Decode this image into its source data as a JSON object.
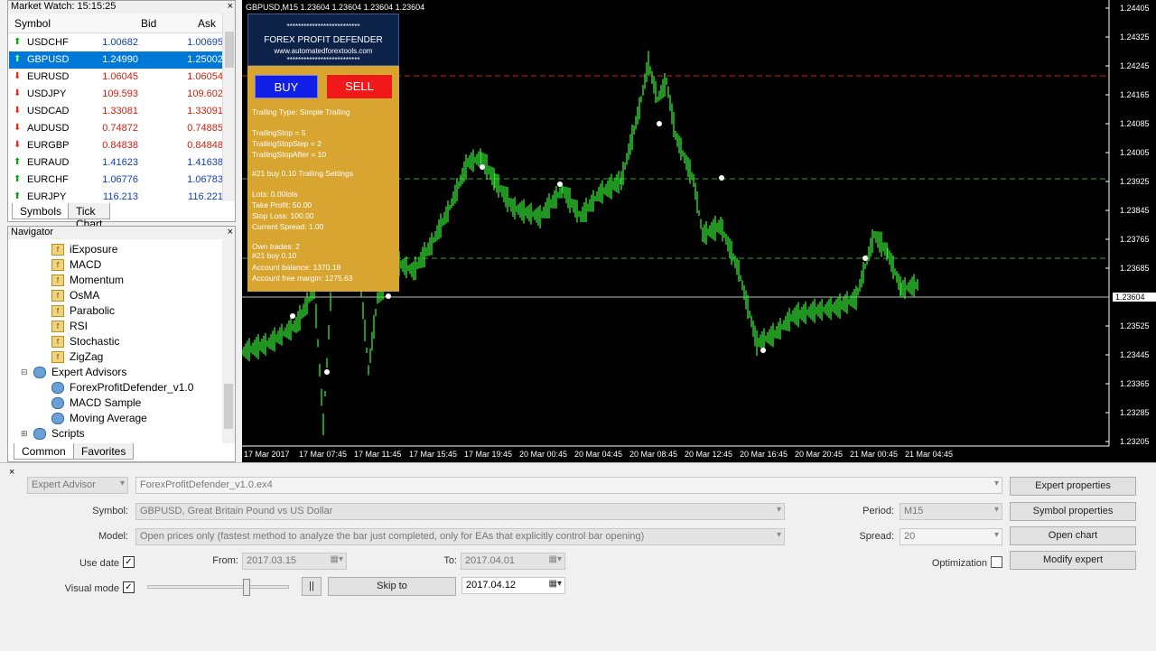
{
  "market_watch": {
    "title": "Market Watch: 15:15:25",
    "col_symbol": "Symbol",
    "col_bid": "Bid",
    "col_ask": "Ask",
    "rows": [
      {
        "symbol": "USDCHF",
        "bid": "1.00682",
        "ask": "1.00695",
        "dir": "up",
        "color": "blue"
      },
      {
        "symbol": "GBPUSD",
        "bid": "1.24990",
        "ask": "1.25002",
        "dir": "up",
        "color": "selected"
      },
      {
        "symbol": "EURUSD",
        "bid": "1.06045",
        "ask": "1.06054",
        "dir": "down",
        "color": "red"
      },
      {
        "symbol": "USDJPY",
        "bid": "109.593",
        "ask": "109.602",
        "dir": "down",
        "color": "red"
      },
      {
        "symbol": "USDCAD",
        "bid": "1.33081",
        "ask": "1.33091",
        "dir": "down",
        "color": "red"
      },
      {
        "symbol": "AUDUSD",
        "bid": "0.74872",
        "ask": "0.74885",
        "dir": "down",
        "color": "red"
      },
      {
        "symbol": "EURGBP",
        "bid": "0.84838",
        "ask": "0.84848",
        "dir": "down",
        "color": "red"
      },
      {
        "symbol": "EURAUD",
        "bid": "1.41623",
        "ask": "1.41638",
        "dir": "up",
        "color": "blue"
      },
      {
        "symbol": "EURCHF",
        "bid": "1.06776",
        "ask": "1.06783",
        "dir": "up",
        "color": "blue"
      },
      {
        "symbol": "EURJPY",
        "bid": "116.213",
        "ask": "116.221",
        "dir": "up",
        "color": "blue"
      }
    ],
    "tabs": [
      "Symbols",
      "Tick Chart"
    ]
  },
  "navigator": {
    "title": "Navigator",
    "items": [
      {
        "label": "iExposure",
        "type": "indicator"
      },
      {
        "label": "MACD",
        "type": "indicator"
      },
      {
        "label": "Momentum",
        "type": "indicator"
      },
      {
        "label": "OsMA",
        "type": "indicator"
      },
      {
        "label": "Parabolic",
        "type": "indicator"
      },
      {
        "label": "RSI",
        "type": "indicator"
      },
      {
        "label": "Stochastic",
        "type": "indicator"
      },
      {
        "label": "ZigZag",
        "type": "indicator"
      },
      {
        "label": "Expert Advisors",
        "type": "folder"
      },
      {
        "label": "ForexProfitDefender_v1.0",
        "type": "ea"
      },
      {
        "label": "MACD Sample",
        "type": "ea"
      },
      {
        "label": "Moving Average",
        "type": "ea"
      },
      {
        "label": "Scripts",
        "type": "folder"
      }
    ],
    "tabs": [
      "Common",
      "Favorites"
    ]
  },
  "chart": {
    "title": "GBPUSD,M15  1.23604 1.23604 1.23604 1.23604",
    "current_price": "1.23604",
    "price_labels": [
      "1.24405",
      "1.24325",
      "1.24245",
      "1.24165",
      "1.24085",
      "1.24005",
      "1.23925",
      "1.23845",
      "1.23765",
      "1.23685",
      "1.23604",
      "1.23525",
      "1.23445",
      "1.23365",
      "1.23285",
      "1.23205"
    ],
    "time_labels": [
      "17 Mar 2017",
      "17 Mar 07:45",
      "17 Mar 11:45",
      "17 Mar 15:45",
      "17 Mar 19:45",
      "20 Mar 00:45",
      "20 Mar 04:45",
      "20 Mar 08:45",
      "20 Mar 12:45",
      "20 Mar 16:45",
      "20 Mar 20:45",
      "21 Mar 00:45",
      "21 Mar 04:45"
    ],
    "colors": {
      "bg": "#000000",
      "candle": "#32e832",
      "grid": "#505050"
    }
  },
  "ea_panel": {
    "stars": "**************************",
    "name": "FOREX PROFIT DEFENDER",
    "url": "www.automatedforextools.com",
    "buy": "BUY",
    "sell": "SELL",
    "trailing_type": "Trailing Type: Simple Trailing",
    "trailing_stop": "TrailingStop = 5",
    "trailing_step": "TrailingStopStep = 2",
    "trailing_after": "TrailingStopAfter = 10",
    "settings": "#21 buy 0.10 Trailing Settings",
    "lots": "Lots: 0.00lots",
    "take_profit": "Take Profit: 50.00",
    "stop_loss": "Stop Loss: 100.00",
    "spread": "Current Spread: 1.00",
    "own_trades": "Own trades: 2",
    "order": "#21 buy 0.10",
    "balance": "Account balance: 1370.18",
    "free_margin": "Account free margin: 1275.63"
  },
  "tester": {
    "type": "Expert Advisor",
    "ea_file": "ForexProfitDefender_v1.0.ex4",
    "symbol_label": "Symbol:",
    "symbol": "GBPUSD, Great Britain Pound vs US Dollar",
    "model_label": "Model:",
    "model": "Open prices only (fastest method to analyze the bar just completed, only for EAs that explicitly control bar opening)",
    "use_date": "Use date",
    "from_label": "From:",
    "from": "2017.03.15",
    "to_label": "To:",
    "to": "2017.04.01",
    "visual_mode": "Visual mode",
    "skip_to": "Skip to",
    "skip_date": "2017.04.12",
    "pause": "||",
    "period_label": "Period:",
    "period": "M15",
    "spread_label": "Spread:",
    "spread": "20",
    "optimization": "Optimization",
    "btn_expert_props": "Expert properties",
    "btn_symbol_props": "Symbol properties",
    "btn_open_chart": "Open chart",
    "btn_modify": "Modify expert",
    "slider_fraction": 0.7
  }
}
